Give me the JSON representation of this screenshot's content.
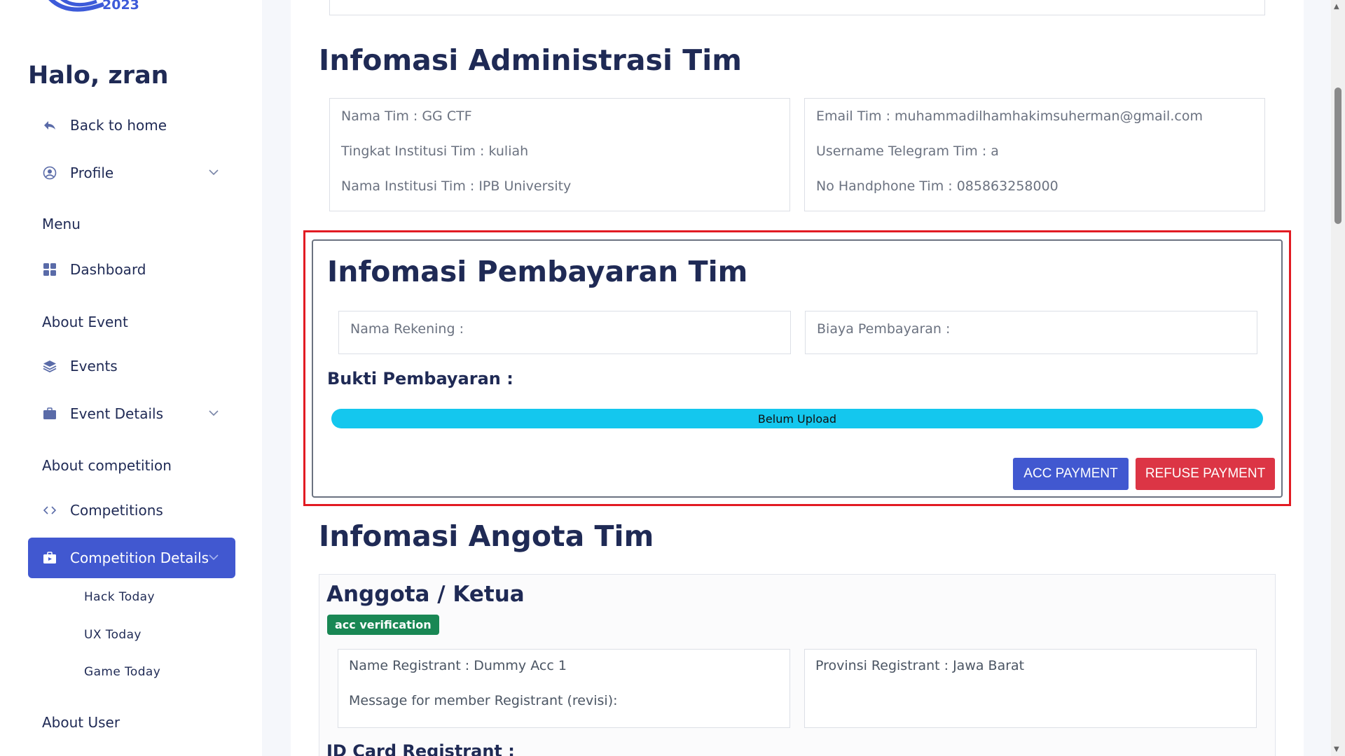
{
  "sidebar": {
    "logo_year": "2023",
    "greeting": "Halo, zran",
    "back_home": "Back to home",
    "profile": "Profile",
    "menu_label": "Menu",
    "dashboard": "Dashboard",
    "about_event_label": "About Event",
    "events": "Events",
    "event_details": "Event Details",
    "about_competition_label": "About competition",
    "competitions": "Competitions",
    "competition_details": "Competition Details",
    "sub_items": [
      "Hack Today",
      "UX Today",
      "Game Today"
    ],
    "about_user_label": "About User"
  },
  "admin": {
    "title": "Infomasi Administrasi Tim",
    "left": [
      "Nama Tim : GG CTF",
      "Tingkat Institusi Tim : kuliah",
      "Nama Institusi Tim : IPB University"
    ],
    "right": [
      "Email Tim : muhammadilhamhakimsuherman@gmail.com",
      "Username Telegram Tim : a",
      "No Handphone Tim : 085863258000"
    ]
  },
  "payment": {
    "title": "Infomasi Pembayaran Tim",
    "nama_rekening": "Nama Rekening :",
    "biaya": "Biaya Pembayaran :",
    "bukti": "Bukti Pembayaran :",
    "status": "Belum Upload",
    "acc_button": "ACC PAYMENT",
    "refuse_button": "REFUSE PAYMENT"
  },
  "members": {
    "title": "Infomasi Angota Tim",
    "member_title": "Anggota / Ketua",
    "badge": "acc verification",
    "left": [
      "Name Registrant : Dummy Acc 1",
      "Message for member Registrant (revisi):"
    ],
    "right": [
      "Provinsi Registrant : Jawa Barat"
    ],
    "id_card": "ID Card Registrant :"
  },
  "colors": {
    "accent": "#4158d0",
    "danger": "#dc3545",
    "progress": "#14c7ee",
    "success": "#198754",
    "highlight": "#e21b23"
  }
}
